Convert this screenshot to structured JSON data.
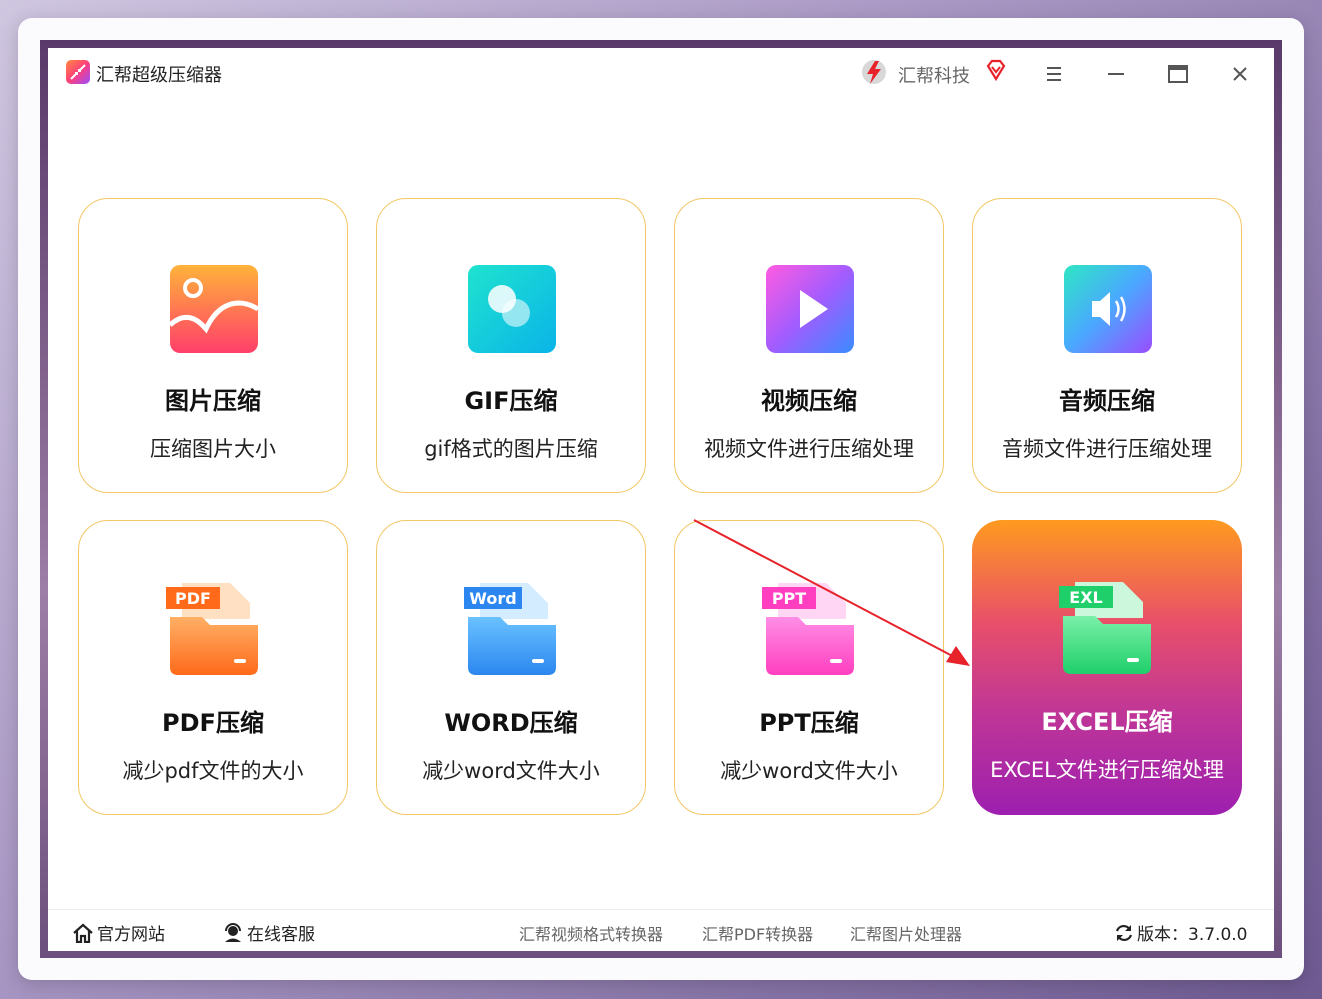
{
  "app": {
    "title": "汇帮超级压缩器",
    "brand": "汇帮科技"
  },
  "colors": {
    "card_border": "#f2c766",
    "active_gradient_top": "#ff9a1f",
    "active_gradient_bottom": "#9d1fb0",
    "arrow": "#e8222a"
  },
  "cards": [
    {
      "title": "图片压缩",
      "desc": "压缩图片大小",
      "icon": "image-icon"
    },
    {
      "title": "GIF压缩",
      "desc": "gif格式的图片压缩",
      "icon": "gif-icon"
    },
    {
      "title": "视频压缩",
      "desc": "视频文件进行压缩处理",
      "icon": "video-play-icon"
    },
    {
      "title": "音频压缩",
      "desc": "音频文件进行压缩处理",
      "icon": "audio-speaker-icon"
    },
    {
      "title": "PDF压缩",
      "desc": "减少pdf文件的大小",
      "icon": "pdf-folder-icon",
      "badge": "PDF"
    },
    {
      "title": "WORD压缩",
      "desc": "减少word文件大小",
      "icon": "word-folder-icon",
      "badge": "Word"
    },
    {
      "title": "PPT压缩",
      "desc": "减少word文件大小",
      "icon": "ppt-folder-icon",
      "badge": "PPT"
    },
    {
      "title": "EXCEL压缩",
      "desc": "EXCEL文件进行压缩处理",
      "icon": "excel-folder-icon",
      "badge": "EXL",
      "active": true
    }
  ],
  "footer": {
    "website": "官方网站",
    "service": "在线客服",
    "links": [
      "汇帮视频格式转换器",
      "汇帮PDF转换器",
      "汇帮图片处理器"
    ],
    "version": "版本：3.7.0.0"
  }
}
